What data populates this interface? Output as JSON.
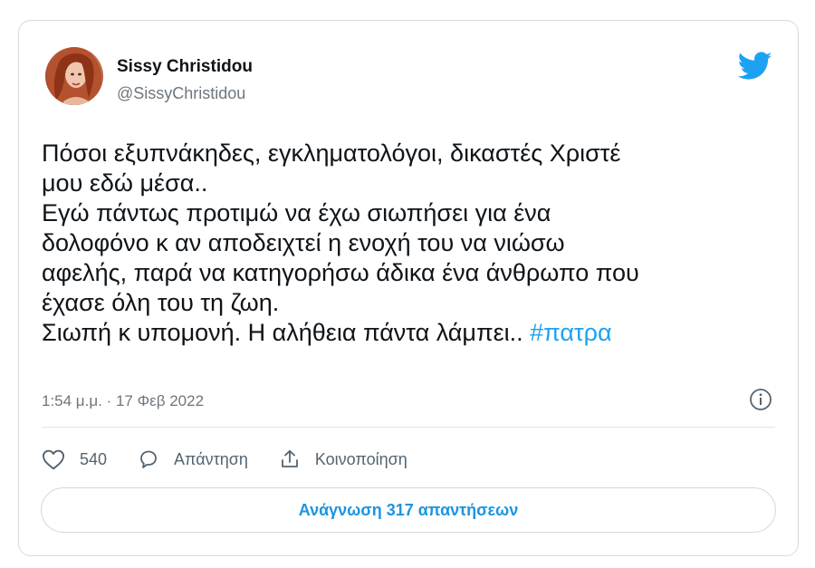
{
  "author": {
    "name": "Sissy Christidou",
    "handle": "@SissyChristidou"
  },
  "tweet": {
    "lines": [
      "Πόσοι εξυπνάκηδες, εγκληματολόγοι, δικαστές Χριστέ",
      "μου εδώ μέσα..",
      "Εγώ πάντως προτιμώ να έχω σιωπήσει για ένα",
      "δολοφόνο κ αν αποδειχτεί η ενοχή του να νιώσω",
      "αφελής, παρά να κατηγορήσω άδικα ένα άνθρωπο που",
      "έχασε όλη του τη ζωη.",
      "Σιωπή κ υπομονή. Η αλήθεια πάντα λάμπει.. "
    ],
    "hashtag": "#πατρα",
    "timestamp": "1:54 μ.μ. · 17 Φεβ 2022"
  },
  "actions": {
    "likes_count": "540",
    "reply_label": "Απάντηση",
    "share_label": "Κοινοποίηση"
  },
  "read_replies_label": "Ανάγνωση 317 απαντήσεων",
  "colors": {
    "accent": "#1da1f2",
    "text": "#0f1419",
    "muted": "#6e767d",
    "border": "#d6dadd"
  },
  "icons": {
    "brand": "twitter-bird-icon",
    "info": "info-icon",
    "like": "heart-icon",
    "reply": "speech-bubble-icon",
    "share": "share-upload-icon"
  }
}
